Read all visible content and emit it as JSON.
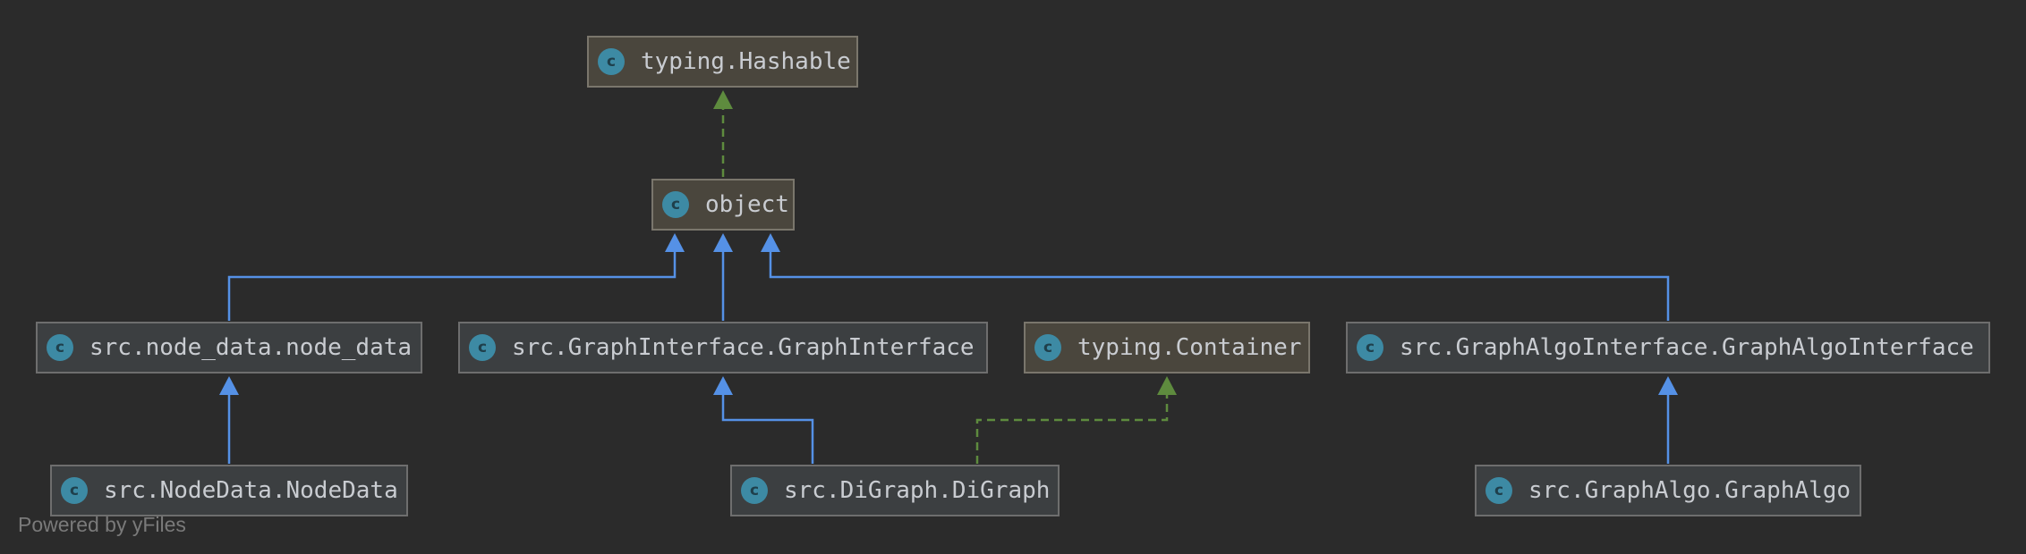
{
  "classes": {
    "hashable": "typing.Hashable",
    "object": "object",
    "node_data": "src.node_data.node_data",
    "graph_interface": "src.GraphInterface.GraphInterface",
    "container": "typing.Container",
    "graph_algo_interface": "src.GraphAlgoInterface.GraphAlgoInterface",
    "node_data_impl": "src.NodeData.NodeData",
    "digraph": "src.DiGraph.DiGraph",
    "graph_algo": "src.GraphAlgo.GraphAlgo"
  },
  "icon_letter": "c",
  "relations": [
    {
      "from": "object",
      "to": "hashable",
      "kind": "implements"
    },
    {
      "from": "node_data",
      "to": "object",
      "kind": "extends"
    },
    {
      "from": "graph_interface",
      "to": "object",
      "kind": "extends"
    },
    {
      "from": "graph_algo_interface",
      "to": "object",
      "kind": "extends"
    },
    {
      "from": "node_data_impl",
      "to": "node_data",
      "kind": "extends"
    },
    {
      "from": "digraph",
      "to": "graph_interface",
      "kind": "extends"
    },
    {
      "from": "digraph",
      "to": "container",
      "kind": "implements"
    },
    {
      "from": "graph_algo",
      "to": "graph_algo_interface",
      "kind": "extends"
    }
  ],
  "colors": {
    "background": "#2b2b2b",
    "extends_edge": "#5591e6",
    "implements_edge": "#5e8b3e",
    "class_icon": "#3d8aa4"
  },
  "footer": "Powered by yFiles"
}
